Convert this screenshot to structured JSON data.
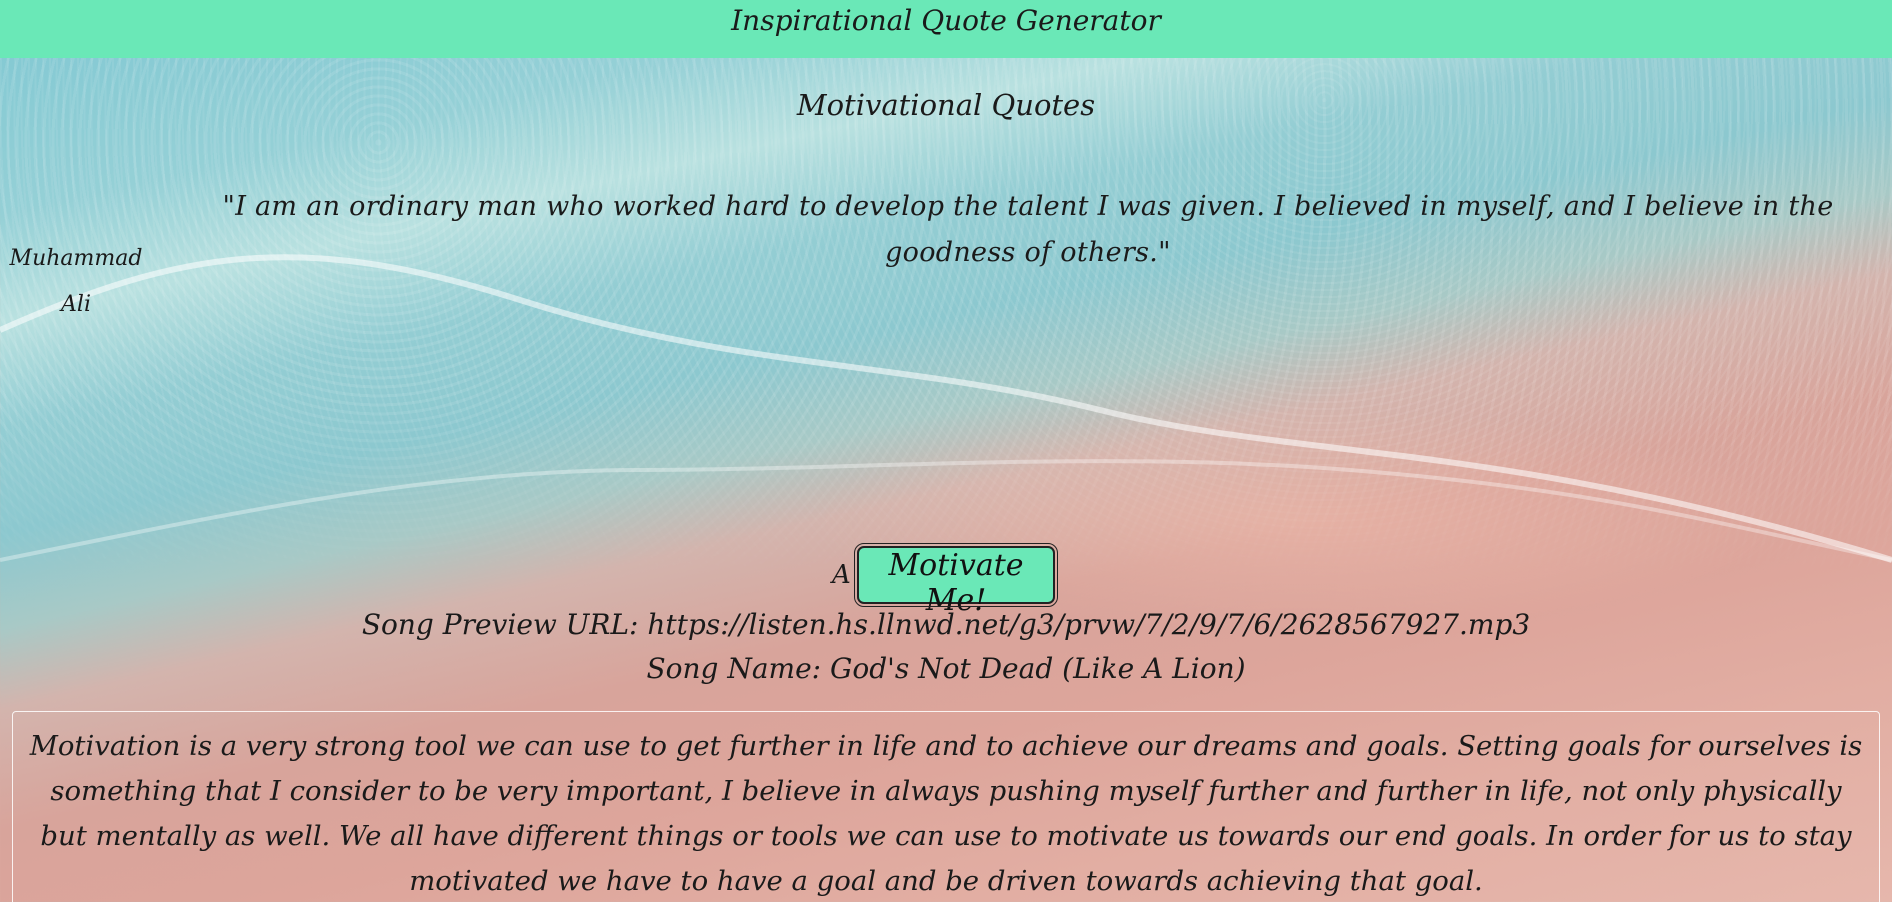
{
  "header": {
    "title": "Inspirational Quote Generator"
  },
  "quote_section": {
    "heading": "Motivational Quotes",
    "quote": "\"I am an ordinary man who worked hard to develop the talent I was given. I believed in myself, and I believe in the goodness of others.\"",
    "author": "Muhammad Ali"
  },
  "music": {
    "artist_label": "A",
    "button_label": "Motivate Me!",
    "song_preview": "Song Preview URL: https://listen.hs.llnwd.net/g3/prvw/7/2/9/7/6/2628567927.mp3",
    "song_name": "Song Name: God's Not Dead (Like A Lion)"
  },
  "essay": {
    "text": "Motivation is a very strong tool we can use to get further in life and to achieve our dreams and goals. Setting goals for ourselves is something that I consider to be very important, I believe in always pushing myself further and further in life, not only physically but mentally as well. We all have different things or tools we can use to motivate us towards our end goals. In order for us to stay motivated we have to have a goal and be driven towards achieving that goal."
  },
  "colors": {
    "header_bg": "#6ae8b7",
    "button_bg": "#6ae8b7",
    "ocean": "#7fc7d2",
    "sand": "#dda59b"
  }
}
